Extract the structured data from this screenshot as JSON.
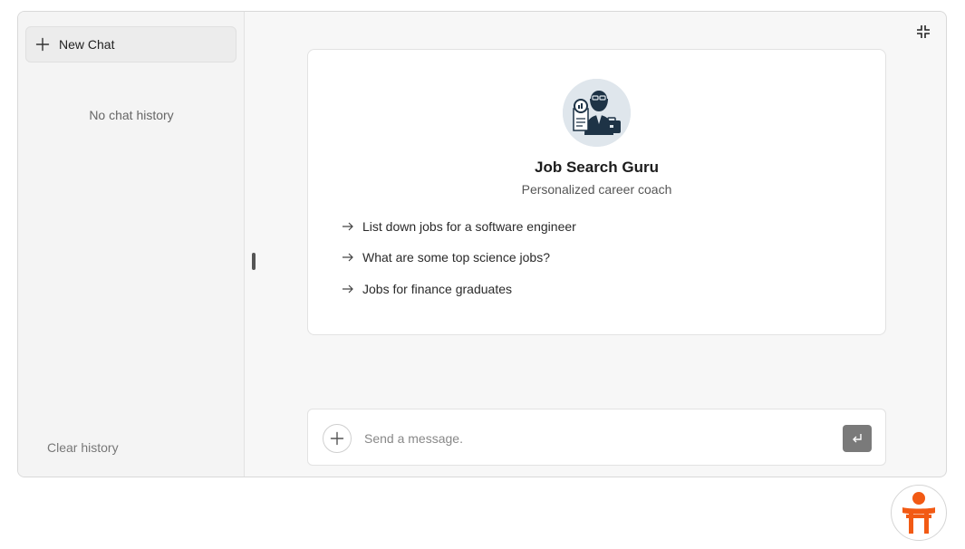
{
  "sidebar": {
    "new_chat_label": "New Chat",
    "empty_label": "No chat history",
    "clear_label": "Clear history"
  },
  "bot": {
    "name": "Job Search Guru",
    "description": "Personalized career coach",
    "avatar_icon": "job-seeker-avatar"
  },
  "suggestions": [
    {
      "label": "List down jobs for a software engineer"
    },
    {
      "label": "What are some top science jobs?"
    },
    {
      "label": "Jobs for finance graduates"
    }
  ],
  "composer": {
    "placeholder": "Send a message.",
    "value": ""
  },
  "icons": {
    "new_chat": "plus-icon",
    "collapse": "collapse-icon",
    "suggestion": "arrow-right-icon",
    "attach": "plus-icon",
    "send": "enter-icon",
    "brand": "torii-person-logo"
  },
  "colors": {
    "brand": "#f25a14",
    "send_button": "#7a7a7a",
    "avatar_dark": "#1e3346"
  }
}
